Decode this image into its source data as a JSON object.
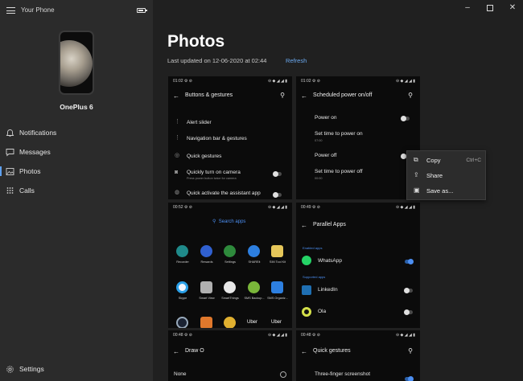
{
  "window": {
    "title": "Your Phone",
    "controls": [
      "minimize",
      "maximize",
      "close"
    ]
  },
  "device": {
    "name": "OnePlus 6"
  },
  "sidebar": {
    "items": [
      {
        "label": "Notifications",
        "icon": "bell-icon"
      },
      {
        "label": "Messages",
        "icon": "message-icon"
      },
      {
        "label": "Photos",
        "icon": "photo-icon",
        "active": true
      },
      {
        "label": "Calls",
        "icon": "dialpad-icon"
      }
    ],
    "settings": {
      "label": "Settings",
      "icon": "gear-icon"
    }
  },
  "main": {
    "title": "Photos",
    "updated": "Last updated on 12-06-2020 at 02:44",
    "refresh": "Refresh"
  },
  "shots": {
    "s1": {
      "time": "01:02",
      "title": "Buttons & gestures",
      "rows": [
        "Alert slider",
        "Navigation bar & gestures",
        "Quick gestures",
        "Quickly turn on camera",
        "Quick activate the assistant app"
      ],
      "camera_sub": "Press power button twice for camera"
    },
    "s2": {
      "time": "01:02",
      "title": "Scheduled power on/off",
      "rows": [
        "Power on",
        "Set time to power on",
        "Power off",
        "Set time to power off"
      ],
      "time1": "07:00",
      "time2": "00:00"
    },
    "s3": {
      "time": "00:52",
      "search": "Search apps",
      "apps_row1": [
        "Recorder",
        "Rewards",
        "Settings",
        "SHAREit",
        "SIM Tool Kit"
      ],
      "apps_row2": [
        "Skype",
        "Smart View",
        "SmartThings",
        "SMS Backup...",
        "SMS Organiz..."
      ],
      "apps_row3": [
        "",
        "",
        "",
        "Uber",
        "Uber"
      ]
    },
    "s4": {
      "time": "00:49",
      "title": "Parallel Apps",
      "enabled_label": "Enabled apps",
      "supported_label": "Supported apps",
      "apps": [
        "WhatsApp",
        "LinkedIn",
        "Ola"
      ]
    },
    "s5": {
      "time": "00:48",
      "title": "Draw O",
      "row": "None"
    },
    "s6": {
      "time": "00:48",
      "title": "Quick gestures",
      "row": "Three-finger screenshot"
    }
  },
  "context_menu": {
    "items": [
      {
        "label": "Copy",
        "shortcut": "Ctrl+C",
        "icon": "copy-icon"
      },
      {
        "label": "Share",
        "icon": "share-icon"
      },
      {
        "label": "Save as...",
        "icon": "save-icon"
      }
    ]
  }
}
